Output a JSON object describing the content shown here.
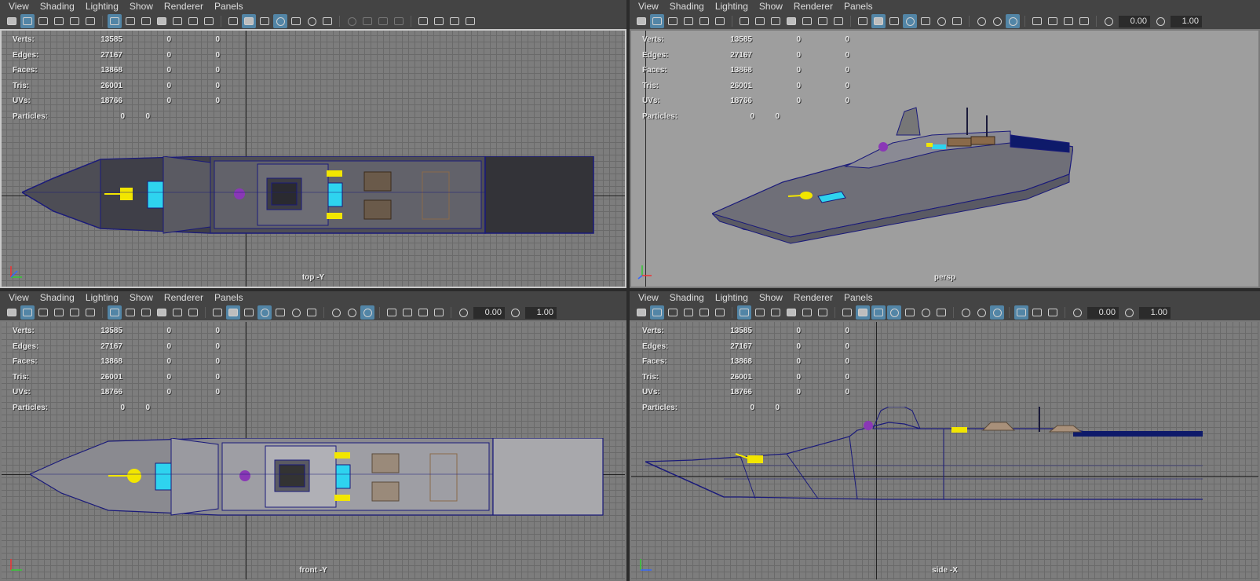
{
  "menus": [
    "View",
    "Shading",
    "Lighting",
    "Show",
    "Renderer",
    "Panels"
  ],
  "field_defaults": {
    "exposure": "0.00",
    "gamma": "1.00"
  },
  "hud": {
    "labels": [
      "Verts:",
      "Edges:",
      "Faces:",
      "Tris:",
      "UVs:"
    ],
    "values": [
      "13585",
      "27167",
      "13868",
      "26001",
      "18766"
    ],
    "zeros": [
      "0",
      "0"
    ],
    "particles_label": "Particles:",
    "particles_values": [
      "0",
      "0"
    ]
  },
  "panels": [
    {
      "id": "top",
      "camera_label": "top -Y",
      "shows_fields": false
    },
    {
      "id": "persp",
      "camera_label": "persp",
      "shows_fields": true
    },
    {
      "id": "front",
      "camera_label": "front -Y",
      "shows_fields": true
    },
    {
      "id": "side",
      "camera_label": "side -X",
      "shows_fields": true
    }
  ],
  "colors": {
    "panel_bg": "#444444",
    "grid_bg": "#7d7d7d",
    "persp_bg": "#9e9e9e",
    "wire": "#1a1a7a",
    "deck_dark": "#3d3d45",
    "accent_yellow": "#f2e600",
    "accent_cyan": "#2ed3ef",
    "accent_purple": "#8a38b6",
    "toggle_on": "#5285a6"
  }
}
